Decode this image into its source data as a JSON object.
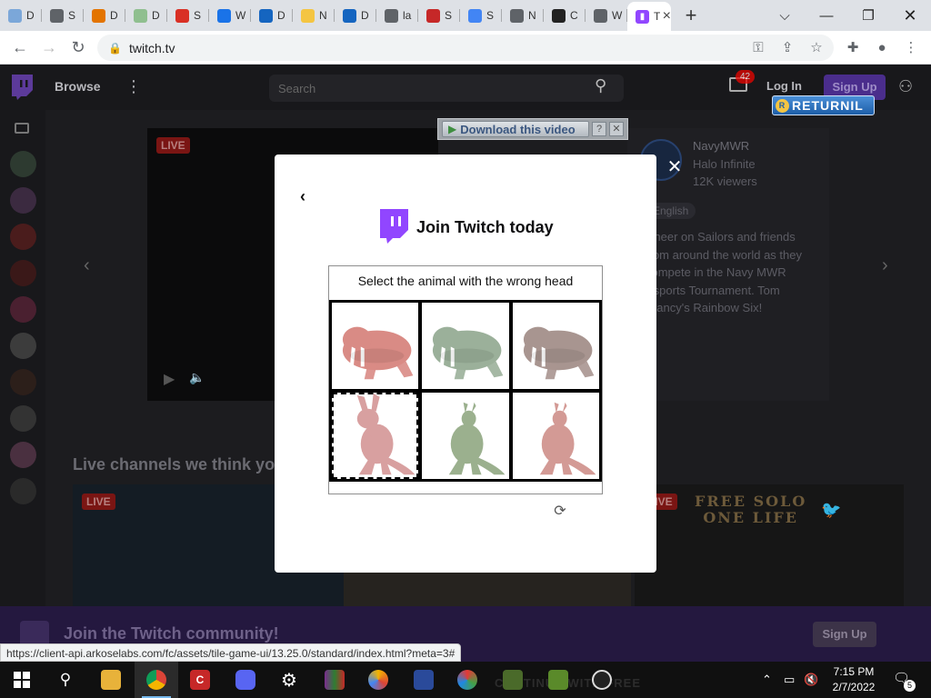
{
  "browser": {
    "tabs": [
      {
        "fav": "D",
        "color": "#7ba7d9",
        "label": "D"
      },
      {
        "fav": "S",
        "color": "#5f6368",
        "label": "S"
      },
      {
        "fav": "D",
        "color": "#e37400",
        "label": "D"
      },
      {
        "fav": "D",
        "color": "#8fbf8f",
        "label": "D"
      },
      {
        "fav": "S",
        "color": "#d93025",
        "label": "S"
      },
      {
        "fav": "W",
        "color": "#1a73e8",
        "label": "W"
      },
      {
        "fav": "D",
        "color": "#1565c0",
        "label": "D"
      },
      {
        "fav": "N",
        "color": "#f4c542",
        "label": "N"
      },
      {
        "fav": "D",
        "color": "#1565c0",
        "label": "D"
      },
      {
        "fav": "la",
        "color": "#5f6368",
        "label": "la"
      },
      {
        "fav": "S",
        "color": "#c62828",
        "label": "S"
      },
      {
        "fav": "S",
        "color": "#4285f4",
        "label": "S"
      },
      {
        "fav": "N",
        "color": "#5f6368",
        "label": "N"
      },
      {
        "fav": "C",
        "color": "#222222",
        "label": "C"
      },
      {
        "fav": "W",
        "color": "#5f6368",
        "label": "W"
      }
    ],
    "active_tab": {
      "label": "Tv",
      "color": "#9146ff"
    },
    "new_tab_label": "+",
    "url": "twitch.tv",
    "status_url": "https://client-api.arkoselabs.com/fc/assets/tile-game-ui/13.25.0/standard/index.html?meta=3#"
  },
  "twitch": {
    "browse": "Browse",
    "search_placeholder": "Search",
    "inbox_count": "42",
    "login": "Log In",
    "signup": "Sign Up",
    "live": "LIVE",
    "featured": {
      "channel": "NavyMWR",
      "game": "Halo Infinite",
      "viewers": "12K viewers",
      "tag": "English",
      "description": "Cheer on Sailors and friends from around the world as they compete in the Navy MWR Esports Tournament. Tom Clancy's Rainbow Six!"
    },
    "live_heading": "Live channels we think you'll like",
    "free_solo": "FREE SOLO\nONE LIFE",
    "community_text": "Join the Twitch community!",
    "community_signup": "Sign Up"
  },
  "overlays": {
    "download_video": "Download this video",
    "download_help": "?",
    "download_close": "✕",
    "returnil": "RETURNIL"
  },
  "modal": {
    "title": "Join Twitch today",
    "close": "✕",
    "back": "‹",
    "captcha_prompt": "Select the animal with the wrong head",
    "tiles": [
      {
        "animal": "walrus",
        "tint": "#d98b85",
        "selected": false
      },
      {
        "animal": "walrus",
        "tint": "#9bb09a",
        "selected": false
      },
      {
        "animal": "walrus",
        "tint": "#a89590",
        "selected": false
      },
      {
        "animal": "kangaroo-rabbit-head",
        "tint": "#d8a0a0",
        "selected": true
      },
      {
        "animal": "kangaroo",
        "tint": "#9bb08e",
        "selected": false
      },
      {
        "animal": "kangaroo",
        "tint": "#d39a95",
        "selected": false
      }
    ],
    "refresh_icon": "refresh-icon"
  },
  "taskbar": {
    "time": "7:15 PM",
    "date": "2/7/2022",
    "notifications": "5",
    "ghost_text": "CONTINUE WITH FREE"
  }
}
